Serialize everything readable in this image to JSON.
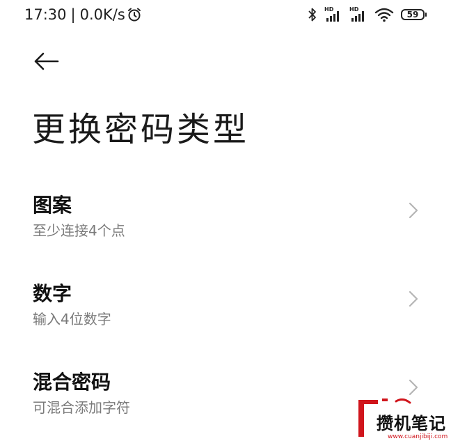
{
  "status_bar": {
    "time": "17:30",
    "separator": "|",
    "network_speed": "0.0K/s",
    "signal_1_label": "HD",
    "signal_2_label": "HD",
    "battery_level": "59"
  },
  "header": {
    "title": "更换密码类型"
  },
  "options": [
    {
      "title": "图案",
      "subtitle": "至少连接4个点"
    },
    {
      "title": "数字",
      "subtitle": "输入4位数字"
    },
    {
      "title": "混合密码",
      "subtitle": "可混合添加字符"
    }
  ],
  "watermark": {
    "text": "攒机笔记",
    "url": "www.cuanjibiji.com",
    "brand_color": "#d0151c"
  },
  "colors": {
    "background": "#ffffff",
    "text_primary": "#111111",
    "text_secondary": "#7a7a7a",
    "chevron": "#b5b5b5"
  }
}
